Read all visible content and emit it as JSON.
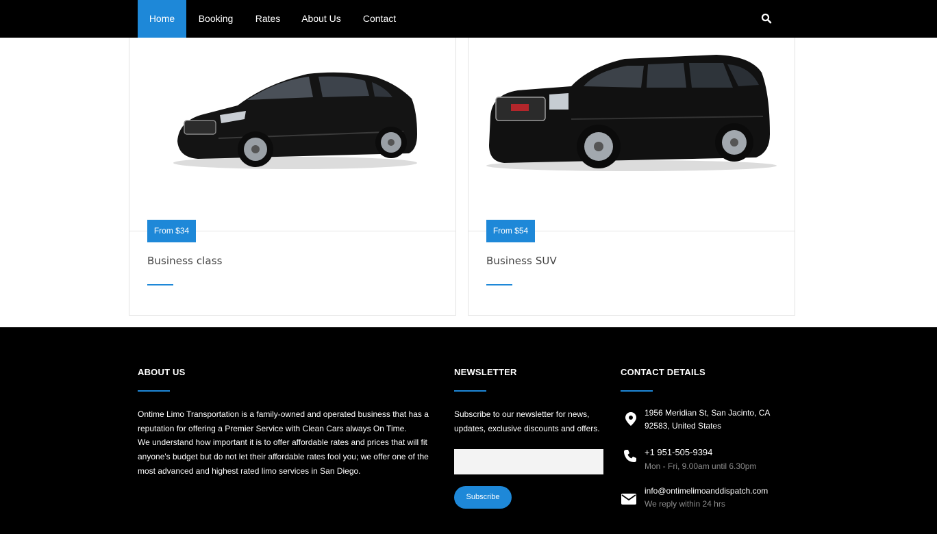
{
  "nav": {
    "items": [
      {
        "label": "Home",
        "active": true
      },
      {
        "label": "Booking",
        "active": false
      },
      {
        "label": "Rates",
        "active": false
      },
      {
        "label": "About Us",
        "active": false
      },
      {
        "label": "Contact",
        "active": false
      }
    ],
    "search_icon": "search-icon"
  },
  "cards": [
    {
      "price": "From $34",
      "title": "Business class",
      "image": "black-sedan-image"
    },
    {
      "price": "From $54",
      "title": "Business SUV",
      "image": "black-suv-image"
    }
  ],
  "footer": {
    "about": {
      "heading": "ABOUT US",
      "paragraph1": "Ontime Limo Transportation is a family-owned and operated business that has a reputation for offering a Premier Service with Clean Cars always On Time.",
      "paragraph2": "We understand how important it is to offer affordable rates and prices that will fit anyone's budget but do not let their affordable rates fool you; we offer one of the most advanced and highest rated limo services in San Diego."
    },
    "newsletter": {
      "heading": "NEWSLETTER",
      "text": "Subscribe to our newsletter for news, updates, exclusive discounts and offers.",
      "input_value": "",
      "button": "Subscribe"
    },
    "contact": {
      "heading": "CONTACT DETAILS",
      "address_line1": "1956 Meridian St, San Jacinto, CA",
      "address_line2": "92583, United States",
      "phone": "+1 951-505-9394",
      "hours": "Mon - Fri, 9.00am until 6.30pm",
      "email": "info@ontimelimoanddispatch.com",
      "reply_note": "We reply within 24 hrs"
    }
  },
  "colors": {
    "accent": "#1e88d8",
    "nav_bg": "#000000",
    "footer_bg": "#000000",
    "muted_text": "#8c8c8c"
  }
}
